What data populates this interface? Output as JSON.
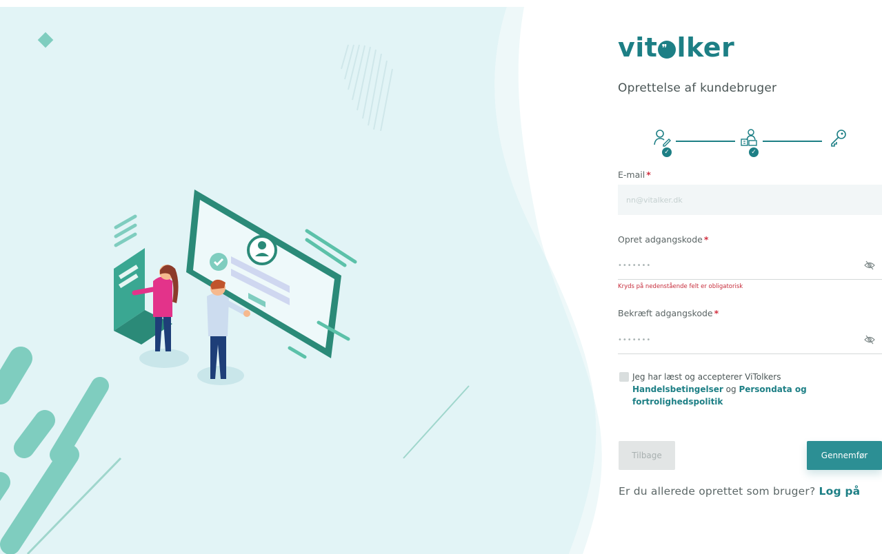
{
  "brand": {
    "logo_name": "vitalker",
    "accent": "#1d7f85",
    "background_tint": "#e2f4f6"
  },
  "page": {
    "title": "Oprettelse af kundebruger"
  },
  "stepper": {
    "steps": [
      {
        "icon": "user-edit-icon",
        "completed": true
      },
      {
        "icon": "company-user-icon",
        "completed": true
      },
      {
        "icon": "key-icon",
        "completed": false
      }
    ]
  },
  "form": {
    "email": {
      "label": "E-mail",
      "required_mark": "*",
      "placeholder": "nn@vitalker.dk"
    },
    "password": {
      "label": "Opret adgangskode",
      "required_mark": "*",
      "placeholder": "•••••••",
      "toggle_icon": "eye-off-icon"
    },
    "password_error": "Kryds på nedenstående felt er obligatorisk",
    "confirm": {
      "label": "Bekræft adgangskode",
      "required_mark": "*",
      "placeholder": "•••••••",
      "toggle_icon": "eye-off-icon"
    },
    "terms": {
      "prefix": "Jeg har læst og accepterer ViTolkers",
      "link1": "Handelsbetingelser",
      "conjunction": " og ",
      "link2": "Persondata og fortrolighedspolitik",
      "checked": false
    }
  },
  "buttons": {
    "back": "Tilbage",
    "submit": "Gennemfør"
  },
  "footer": {
    "question": "Er du allerede oprettet som bruger?",
    "login_link": "Log på"
  }
}
